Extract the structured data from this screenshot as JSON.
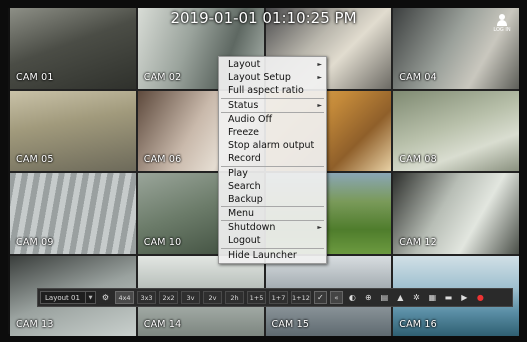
{
  "overlay": {
    "datetime": "2019-01-01 01:10:25 PM",
    "login_label": "LOG IN"
  },
  "cameras": [
    {
      "label": "CAM 01"
    },
    {
      "label": "CAM 02"
    },
    {
      "label": ""
    },
    {
      "label": "CAM 04"
    },
    {
      "label": "CAM 05"
    },
    {
      "label": "CAM 06"
    },
    {
      "label": ""
    },
    {
      "label": "CAM 08"
    },
    {
      "label": "CAM 09"
    },
    {
      "label": "CAM 10"
    },
    {
      "label": ""
    },
    {
      "label": "CAM 12"
    },
    {
      "label": "CAM 13"
    },
    {
      "label": "CAM 14"
    },
    {
      "label": "CAM 15"
    },
    {
      "label": "CAM 16"
    }
  ],
  "context_menu": {
    "items": [
      {
        "label": "Layout",
        "submenu": true
      },
      {
        "label": "Layout Setup",
        "submenu": true
      },
      {
        "label": "Full aspect ratio",
        "submenu": false
      },
      {
        "label": "Status",
        "submenu": true
      },
      {
        "label": "Audio Off",
        "submenu": false
      },
      {
        "label": "Freeze",
        "submenu": false
      },
      {
        "label": "Stop alarm output",
        "submenu": false
      },
      {
        "label": "Record",
        "submenu": false
      },
      {
        "label": "Play",
        "submenu": false
      },
      {
        "label": "Search",
        "submenu": false
      },
      {
        "label": "Backup",
        "submenu": false
      },
      {
        "label": "Menu",
        "submenu": false
      },
      {
        "label": "Shutdown",
        "submenu": true
      },
      {
        "label": "Logout",
        "submenu": false
      },
      {
        "label": "Hide Launcher",
        "submenu": false
      }
    ],
    "submenu_arrow": "►"
  },
  "launcher": {
    "layout_value": "Layout 01",
    "layout_dropdown_icon": "▼",
    "split_buttons": [
      "4x4",
      "3x3",
      "2x2",
      "3v",
      "2v",
      "2h",
      "1+5",
      "1+7",
      "1+12"
    ],
    "active_split": "4x4",
    "collapse_glyph": "«",
    "icons": [
      {
        "name": "audio-icon",
        "glyph": "◐"
      },
      {
        "name": "zoom-icon",
        "glyph": "⊕"
      },
      {
        "name": "freeze-icon",
        "glyph": "▤"
      },
      {
        "name": "alarm-icon",
        "glyph": "▲"
      },
      {
        "name": "ptz-icon",
        "glyph": "✲"
      },
      {
        "name": "capture-icon",
        "glyph": "▦"
      },
      {
        "name": "search-icon",
        "glyph": "▬"
      },
      {
        "name": "play-icon",
        "glyph": "▶"
      },
      {
        "name": "record-icon",
        "glyph": "●"
      }
    ],
    "colors": {
      "record": "#e33333"
    }
  }
}
